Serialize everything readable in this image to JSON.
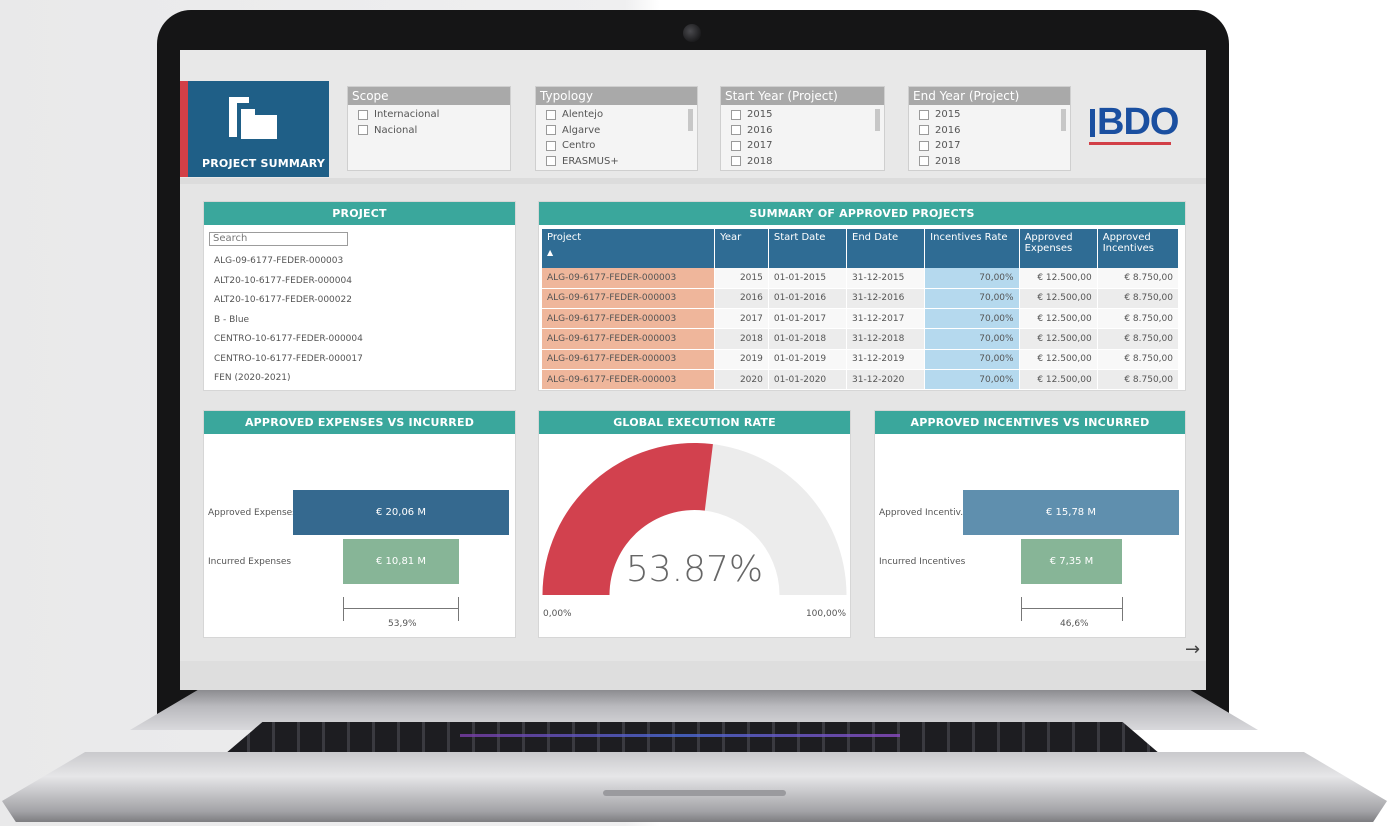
{
  "app": {
    "tile_title": "PROJECT SUMMARY",
    "logo_text": "BDO",
    "colors": {
      "tile": "#1f5f87",
      "accent_red": "#d23f47",
      "panel_header": "#3aa79c",
      "logo": "#1a4fa0"
    }
  },
  "filters": {
    "scope": {
      "label": "Scope",
      "options": [
        "Internacional",
        "Nacional"
      ]
    },
    "typology": {
      "label": "Typology",
      "options": [
        "Alentejo",
        "Algarve",
        "Centro",
        "ERASMUS+"
      ]
    },
    "start_year": {
      "label": "Start Year (Project)",
      "options": [
        "2015",
        "2016",
        "2017",
        "2018"
      ]
    },
    "end_year": {
      "label": "End Year (Project)",
      "options": [
        "2015",
        "2016",
        "2017",
        "2018"
      ]
    }
  },
  "project_panel": {
    "title": "PROJECT",
    "search_placeholder": "Search",
    "items": [
      "ALG-09-6177-FEDER-000003",
      "ALT20-10-6177-FEDER-000004",
      "ALT20-10-6177-FEDER-000022",
      "B - Blue",
      "CENTRO-10-6177-FEDER-000004",
      "CENTRO-10-6177-FEDER-000017",
      "FEN (2020-2021)"
    ]
  },
  "summary_table": {
    "title": "SUMMARY OF APPROVED PROJECTS",
    "columns": [
      "Project",
      "Year",
      "Start Date",
      "End Date",
      "Incentives Rate",
      "Approved Expenses",
      "Approved Incentives"
    ],
    "rows": [
      [
        "ALG-09-6177-FEDER-000003",
        "2015",
        "01-01-2015",
        "31-12-2015",
        "70,00%",
        "€ 12.500,00",
        "€ 8.750,00"
      ],
      [
        "ALG-09-6177-FEDER-000003",
        "2016",
        "01-01-2016",
        "31-12-2016",
        "70,00%",
        "€ 12.500,00",
        "€ 8.750,00"
      ],
      [
        "ALG-09-6177-FEDER-000003",
        "2017",
        "01-01-2017",
        "31-12-2017",
        "70,00%",
        "€ 12.500,00",
        "€ 8.750,00"
      ],
      [
        "ALG-09-6177-FEDER-000003",
        "2018",
        "01-01-2018",
        "31-12-2018",
        "70,00%",
        "€ 12.500,00",
        "€ 8.750,00"
      ],
      [
        "ALG-09-6177-FEDER-000003",
        "2019",
        "01-01-2019",
        "31-12-2019",
        "70,00%",
        "€ 12.500,00",
        "€ 8.750,00"
      ],
      [
        "ALG-09-6177-FEDER-000003",
        "2020",
        "01-01-2020",
        "31-12-2020",
        "70,00%",
        "€ 12.500,00",
        "€ 8.750,00"
      ]
    ]
  },
  "expenses_panel": {
    "title": "APPROVED EXPENSES VS INCURRED",
    "approved_label": "Approved Expenses",
    "approved_value": "€ 20,06 M",
    "incurred_label": "Incurred Expenses",
    "incurred_value": "€ 10,81 M",
    "ratio": "53,9%",
    "colors": {
      "approved": "#35698f",
      "incurred": "#87b597"
    }
  },
  "gauge_panel": {
    "title": "GLOBAL EXECUTION RATE",
    "value_text": "53.87%",
    "value": 53.87,
    "min_label": "0,00%",
    "max_label": "100,00%",
    "colors": {
      "fill": "#d2414e",
      "track": "#ececec"
    }
  },
  "incentives_panel": {
    "title": "APPROVED INCENTIVES VS INCURRED",
    "approved_label": "Approved Incentiv...",
    "approved_value": "€ 15,78 M",
    "incurred_label": "Incurred Incentives",
    "incurred_value": "€ 7,35 M",
    "ratio": "46,6%",
    "colors": {
      "approved": "#5f8fae",
      "incurred": "#87b597"
    }
  }
}
